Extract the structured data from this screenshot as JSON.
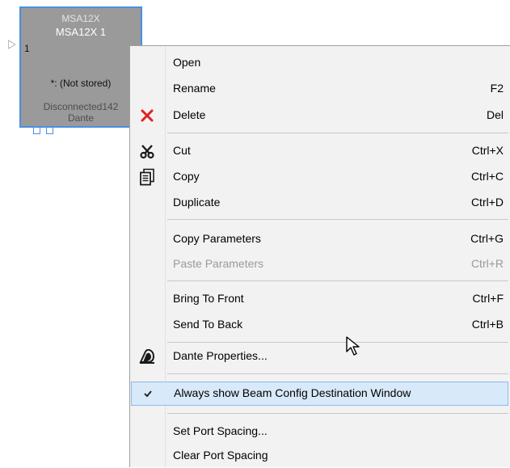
{
  "device": {
    "model": "MSA12X",
    "name": "MSA12X 1",
    "port_number": "1",
    "status": "*: (Not stored)",
    "connection": "Disconnected142",
    "network": "Dante"
  },
  "menu": {
    "items": [
      {
        "label": "Open",
        "shortcut": "",
        "icon": "",
        "disabled": false
      },
      {
        "label": "Rename",
        "shortcut": "F2",
        "icon": "",
        "disabled": false
      },
      {
        "label": "Delete",
        "shortcut": "Del",
        "icon": "delete-x-icon",
        "disabled": false
      },
      {
        "label": "Cut",
        "shortcut": "Ctrl+X",
        "icon": "scissors-icon",
        "disabled": false
      },
      {
        "label": "Copy",
        "shortcut": "Ctrl+C",
        "icon": "copy-icon",
        "disabled": false
      },
      {
        "label": "Duplicate",
        "shortcut": "Ctrl+D",
        "icon": "",
        "disabled": false
      },
      {
        "label": "Copy Parameters",
        "shortcut": "Ctrl+G",
        "icon": "",
        "disabled": false
      },
      {
        "label": "Paste Parameters",
        "shortcut": "Ctrl+R",
        "icon": "",
        "disabled": true
      },
      {
        "label": "Bring To Front",
        "shortcut": "Ctrl+F",
        "icon": "",
        "disabled": false
      },
      {
        "label": "Send To Back",
        "shortcut": "Ctrl+B",
        "icon": "",
        "disabled": false
      },
      {
        "label": "Dante Properties...",
        "shortcut": "",
        "icon": "dante-logo-icon",
        "disabled": false
      },
      {
        "label": "Always show Beam Config Destination Window",
        "shortcut": "",
        "icon": "checkmark-icon",
        "disabled": false,
        "checked": true,
        "highlighted": true
      },
      {
        "label": "Set Port Spacing...",
        "shortcut": "",
        "icon": "",
        "disabled": false
      },
      {
        "label": "Clear Port Spacing",
        "shortcut": "",
        "icon": "",
        "disabled": false
      }
    ]
  },
  "colors": {
    "device_fill": "#9a9a9a",
    "device_border": "#4a8fe0",
    "menu_bg": "#f2f2f2",
    "highlight_bg": "#d8e9f9",
    "highlight_border": "#8cbbec",
    "delete_red": "#e02020",
    "disabled_text": "#9a9a9a"
  }
}
